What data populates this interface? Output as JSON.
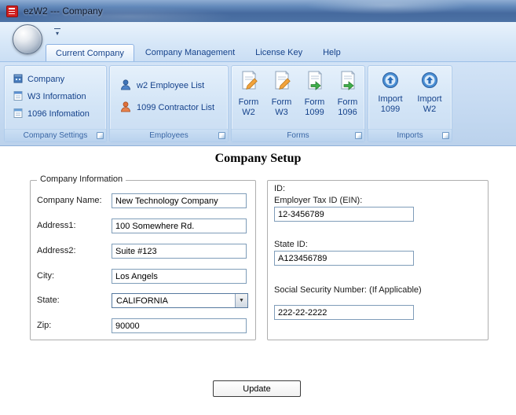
{
  "window": {
    "title": "ezW2 --- Company"
  },
  "colors": {
    "titlebar_blue": "#45699e",
    "ribbon_text_blue": "#15428b",
    "app_icon_red": "#cf1f1f",
    "group_strip_blue": "#3a67a5"
  },
  "ribbon": {
    "tabs": [
      {
        "label": "Current Company"
      },
      {
        "label": "Company Management"
      },
      {
        "label": "License Key"
      },
      {
        "label": "Help"
      }
    ],
    "groups": {
      "company_settings": {
        "label": "Company Settings",
        "items": [
          {
            "label": "Company"
          },
          {
            "label": "W3 Information"
          },
          {
            "label": "1096 Infomation"
          }
        ]
      },
      "employees": {
        "label": "Employees",
        "items": [
          {
            "label": "w2 Employee List"
          },
          {
            "label": "1099 Contractor List"
          }
        ]
      },
      "forms": {
        "label": "Forms",
        "items": [
          {
            "line1": "Form",
            "line2": "W2"
          },
          {
            "line1": "Form",
            "line2": "W3"
          },
          {
            "line1": "Form",
            "line2": "1099"
          },
          {
            "line1": "Form",
            "line2": "1096"
          }
        ]
      },
      "imports": {
        "label": "Imports",
        "items": [
          {
            "line1": "Import",
            "line2": "1099"
          },
          {
            "line1": "Import",
            "line2": "W2"
          }
        ]
      }
    }
  },
  "main": {
    "title": "Company Setup",
    "company_info": {
      "legend": "Company Information",
      "fields": [
        {
          "label": "Company Name:",
          "value": "New Technology Company"
        },
        {
          "label": "Address1:",
          "value": "100 Somewhere Rd."
        },
        {
          "label": "Address2:",
          "value": "Suite #123"
        },
        {
          "label": "City:",
          "value": "Los Angels"
        },
        {
          "label": "State:",
          "value": "CALIFORNIA"
        },
        {
          "label": "Zip:",
          "value": "90000"
        }
      ]
    },
    "ids": {
      "heading": "ID:",
      "ein_label": "Employer Tax ID (EIN):",
      "ein_value": "12-3456789",
      "state_id_label": "State ID:",
      "state_id_value": "A123456789",
      "ssn_label": "Social Security Number: (If Applicable)",
      "ssn_value": "222-22-2222"
    },
    "update_button": "Update"
  }
}
